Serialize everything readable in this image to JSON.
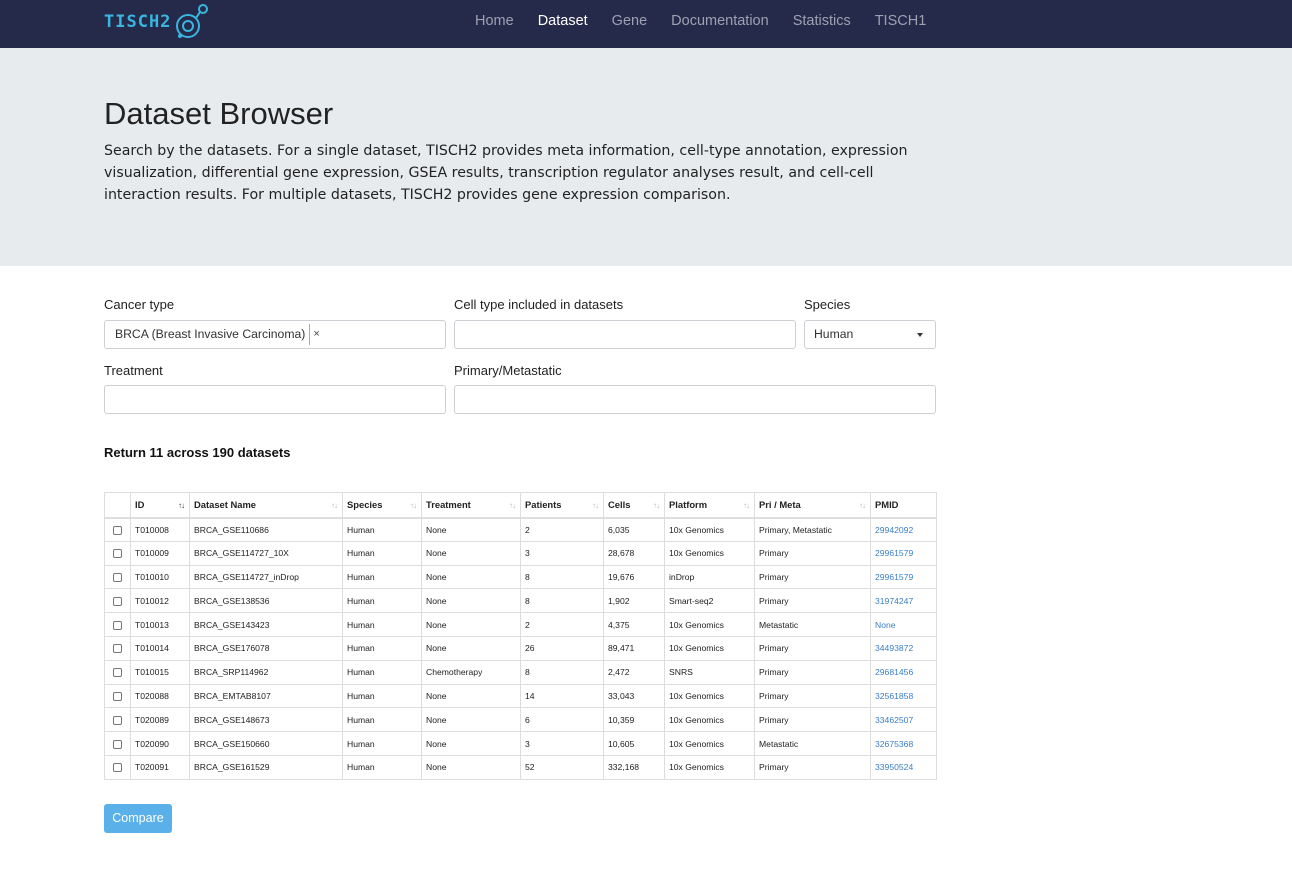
{
  "brand": {
    "name": "TISCH2"
  },
  "nav": [
    {
      "label": "Home",
      "active": false
    },
    {
      "label": "Dataset",
      "active": true
    },
    {
      "label": "Gene",
      "active": false
    },
    {
      "label": "Documentation",
      "active": false
    },
    {
      "label": "Statistics",
      "active": false
    },
    {
      "label": "TISCH1",
      "active": false
    }
  ],
  "header": {
    "title": "Dataset Browser",
    "description": "Search by the datasets. For a single dataset, TISCH2 provides meta information, cell-type annotation, expression visualization, differential gene expression, GSEA results, transcription regulator analyses result, and cell-cell interaction results. For multiple datasets, TISCH2 provides gene expression comparison."
  },
  "filters": {
    "cancer_type": {
      "label": "Cancer type",
      "selected_tag": "BRCA (Breast Invasive Carcinoma)",
      "remove_glyph": "×"
    },
    "cell_type": {
      "label": "Cell type included in datasets",
      "value": ""
    },
    "species": {
      "label": "Species",
      "value": "Human"
    },
    "treatment": {
      "label": "Treatment",
      "value": ""
    },
    "primary_metastatic": {
      "label": "Primary/Metastatic",
      "value": ""
    }
  },
  "result_text": "Return 11 across 190 datasets",
  "table": {
    "columns": [
      "ID",
      "Dataset Name",
      "Species",
      "Treatment",
      "Patients",
      "Cells",
      "Platform",
      "Pri / Meta",
      "PMID"
    ],
    "rows": [
      [
        "T010008",
        "BRCA_GSE110686",
        "Human",
        "None",
        "2",
        "6,035",
        "10x Genomics",
        "Primary, Metastatic",
        "29942092"
      ],
      [
        "T010009",
        "BRCA_GSE114727_10X",
        "Human",
        "None",
        "3",
        "28,678",
        "10x Genomics",
        "Primary",
        "29961579"
      ],
      [
        "T010010",
        "BRCA_GSE114727_inDrop",
        "Human",
        "None",
        "8",
        "19,676",
        "inDrop",
        "Primary",
        "29961579"
      ],
      [
        "T010012",
        "BRCA_GSE138536",
        "Human",
        "None",
        "8",
        "1,902",
        "Smart-seq2",
        "Primary",
        "31974247"
      ],
      [
        "T010013",
        "BRCA_GSE143423",
        "Human",
        "None",
        "2",
        "4,375",
        "10x Genomics",
        "Metastatic",
        "None"
      ],
      [
        "T010014",
        "BRCA_GSE176078",
        "Human",
        "None",
        "26",
        "89,471",
        "10x Genomics",
        "Primary",
        "34493872"
      ],
      [
        "T010015",
        "BRCA_SRP114962",
        "Human",
        "Chemotherapy",
        "8",
        "2,472",
        "SNRS",
        "Primary",
        "29681456"
      ],
      [
        "T020088",
        "BRCA_EMTAB8107",
        "Human",
        "None",
        "14",
        "33,043",
        "10x Genomics",
        "Primary",
        "32561858"
      ],
      [
        "T020089",
        "BRCA_GSE148673",
        "Human",
        "None",
        "6",
        "10,359",
        "10x Genomics",
        "Primary",
        "33462507"
      ],
      [
        "T020090",
        "BRCA_GSE150660",
        "Human",
        "None",
        "3",
        "10,605",
        "10x Genomics",
        "Metastatic",
        "32675368"
      ],
      [
        "T020091",
        "BRCA_GSE161529",
        "Human",
        "None",
        "52",
        "332,168",
        "10x Genomics",
        "Primary",
        "33950524"
      ]
    ]
  },
  "compare_button": "Compare"
}
